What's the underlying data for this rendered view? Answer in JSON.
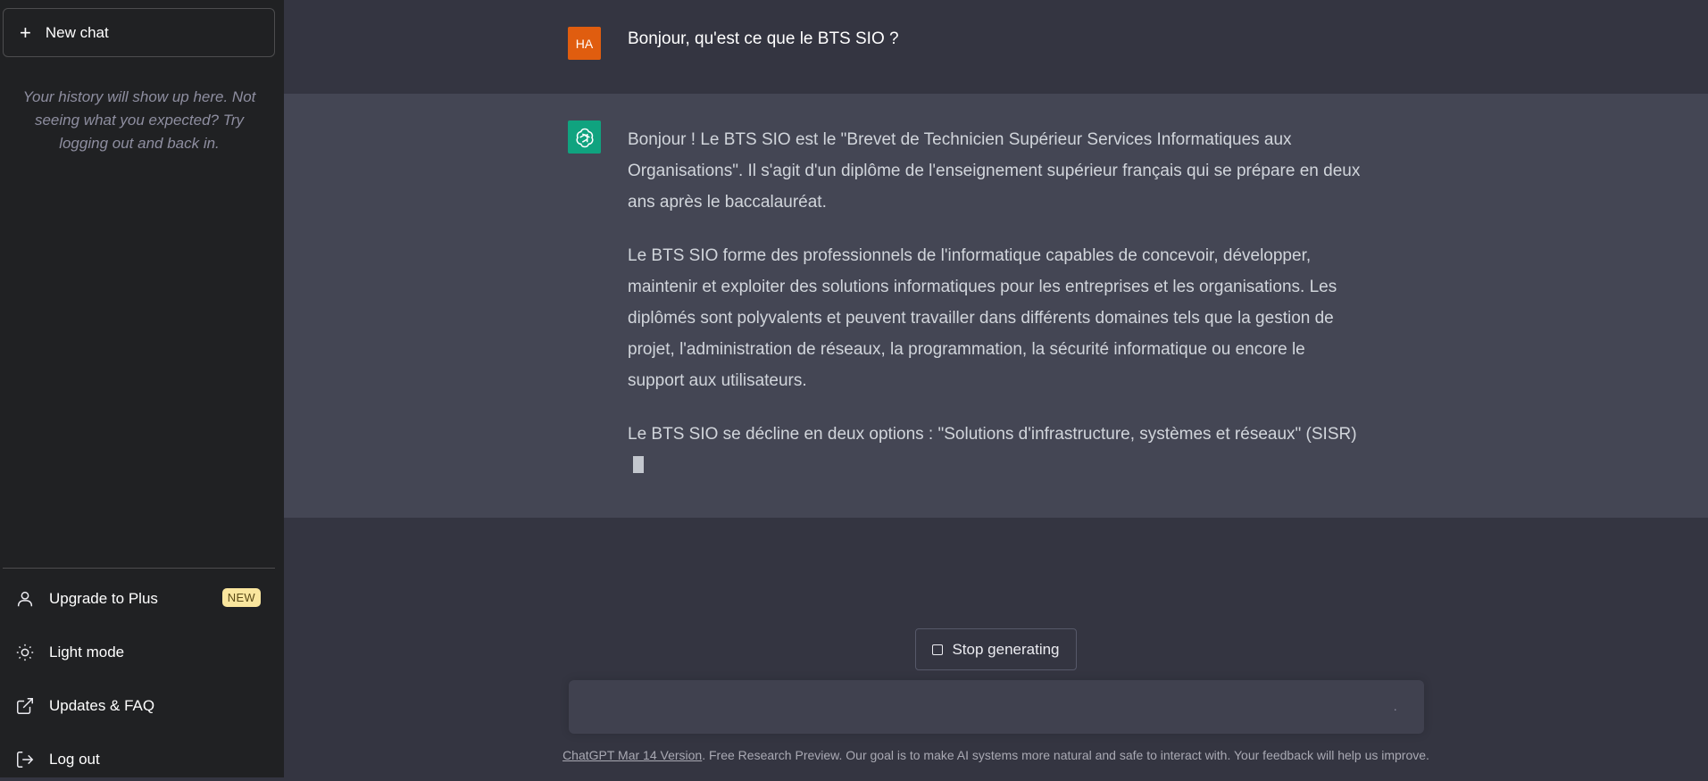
{
  "sidebar": {
    "new_chat_label": "New chat",
    "history_note": "Your history will show up here. Not seeing what you expected? Try logging out and back in.",
    "items": [
      {
        "label": "Upgrade to Plus",
        "icon": "user-icon",
        "badge": "NEW"
      },
      {
        "label": "Light mode",
        "icon": "sun-icon"
      },
      {
        "label": "Updates & FAQ",
        "icon": "external-link-icon"
      },
      {
        "label": "Log out",
        "icon": "logout-icon"
      }
    ]
  },
  "conversation": {
    "user": {
      "avatar_initials": "HA",
      "avatar_color": "#e05d0f",
      "text": "Bonjour, qu'est ce que le BTS SIO ?"
    },
    "assistant": {
      "avatar_icon": "openai-logo-icon",
      "avatar_color": "#10a37f",
      "paragraphs": [
        "Bonjour ! Le BTS SIO est le \"Brevet de Technicien Supérieur Services Informatiques aux Organisations\". Il s'agit d'un diplôme de l'enseignement supérieur français qui se prépare en deux ans après le baccalauréat.",
        "Le BTS SIO forme des professionnels de l'informatique capables de concevoir, développer, maintenir et exploiter des solutions informatiques pour les entreprises et les organisations. Les diplômés sont polyvalents et peuvent travailler dans différents domaines tels que la gestion de projet, l'administration de réseaux, la programmation, la sécurité informatique ou encore le support aux utilisateurs.",
        "Le BTS SIO se décline en deux options : \"Solutions d'infrastructure, systèmes et réseaux\" (SISR)"
      ]
    }
  },
  "controls": {
    "stop_label": "Stop generating",
    "input_value": "",
    "input_status": "·"
  },
  "footer": {
    "link_text": "ChatGPT Mar 14 Version",
    "text": ". Free Research Preview. Our goal is to make AI systems more natural and safe to interact with. Your feedback will help us improve."
  }
}
